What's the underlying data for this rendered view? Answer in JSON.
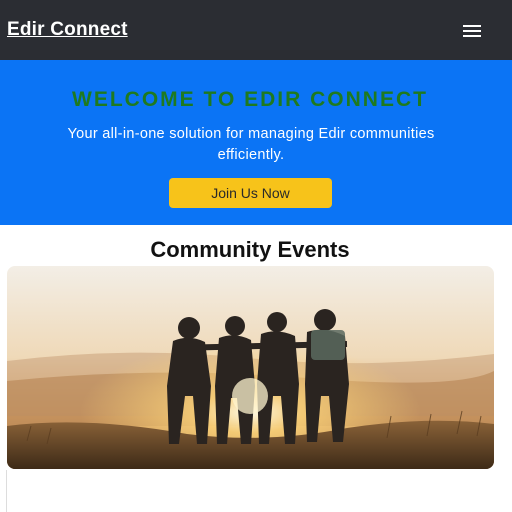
{
  "navbar": {
    "brand": "Edir Connect",
    "menu_icon": "hamburger-menu-icon"
  },
  "hero": {
    "title": "WELCOME TO EDIR CONNECT",
    "subtitle": "Your all-in-one solution for managing Edir communities efficiently.",
    "cta_label": "Join Us Now"
  },
  "events": {
    "section_title": "Community Events"
  },
  "colors": {
    "navbar_bg": "#2b2d33",
    "hero_bg": "#0b74f5",
    "hero_title": "#1f7a1f",
    "cta_bg": "#f7c31a"
  }
}
